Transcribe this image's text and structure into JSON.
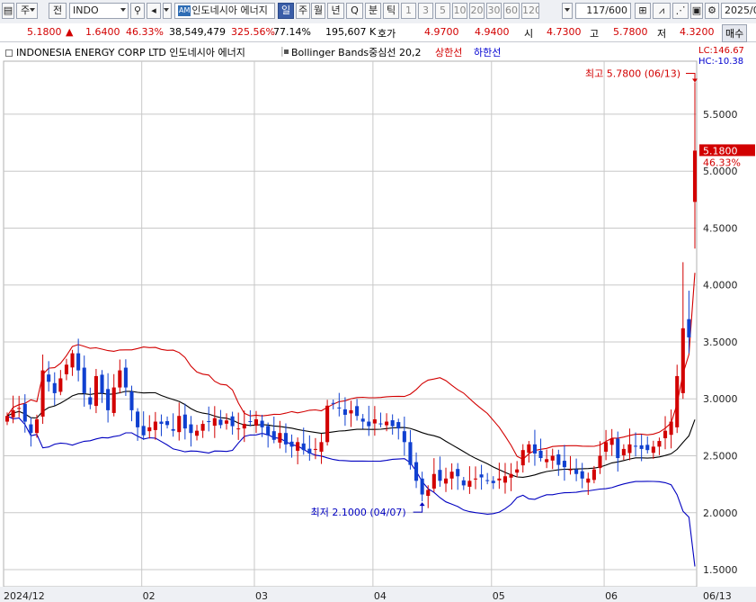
{
  "toolbar": {
    "market": "주",
    "prev": "전",
    "symbol": "INDO",
    "stock_name": "인도네시아 에너지",
    "am_badge": "AM",
    "periods": [
      "일",
      "주",
      "월",
      "년",
      "Q",
      "분",
      "틱"
    ],
    "selected_period": "일",
    "intervals": [
      "1",
      "3",
      "5",
      "10",
      "20",
      "30",
      "60",
      "120"
    ],
    "count": "117",
    "count_total": "/600",
    "date": "2025/0",
    "order_button": "매수"
  },
  "quote": {
    "price": "5.1800",
    "change": "1.6400",
    "change_pct": "46.33%",
    "volume": "38,549,479",
    "volume_ratio": "325.56%",
    "turnover": "77.14%",
    "amount": "195,607 K",
    "bid_label": "호가",
    "ask": "4.9700",
    "bid": "4.9400",
    "open_label": "시",
    "open": "4.7300",
    "high_label": "고",
    "high": "5.7800",
    "low_label": "저",
    "low": "4.3200"
  },
  "colors": {
    "up": "#d20000",
    "down": "#1040d0",
    "upper_band": "#d20000",
    "lower_band": "#0000c0",
    "middle_band": "#000000",
    "grid": "#c8c8c8"
  },
  "chart_data": {
    "type": "candlestick",
    "title": "INDONESIA ENERGY CORP LTD  인도네시아 에너지",
    "indicator_label": "Bollinger Bands중심선 20,2",
    "legend": [
      {
        "name": "상한선",
        "color": "#d20000"
      },
      {
        "name": "하한선",
        "color": "#0000c0"
      }
    ],
    "lc_label": "LC:146.67",
    "hc_label": "HC:-10.38",
    "ylim": [
      1.35,
      5.95
    ],
    "y_ticks": [
      "5.5000",
      "5.0000",
      "4.5000",
      "4.0000",
      "3.5000",
      "3.0000",
      "2.5000",
      "2.0000",
      "1.5000"
    ],
    "y_tick_values": [
      5.5,
      5.0,
      4.5,
      4.0,
      3.5,
      3.0,
      2.5,
      2.0,
      1.5
    ],
    "x_labels": [
      "2024/12",
      "02",
      "03",
      "04",
      "05",
      "06",
      "06/13"
    ],
    "x_label_index": [
      0,
      23,
      42,
      62,
      82,
      101,
      115
    ],
    "last_price_label": "5.1800",
    "last_change_label": "46.33%",
    "high_annotation": "최고 5.7800 (06/13)",
    "low_annotation": "최저 2.1000 (04/07)",
    "last_price": 5.18,
    "period_high": 5.78,
    "period_low": 2.1
  }
}
